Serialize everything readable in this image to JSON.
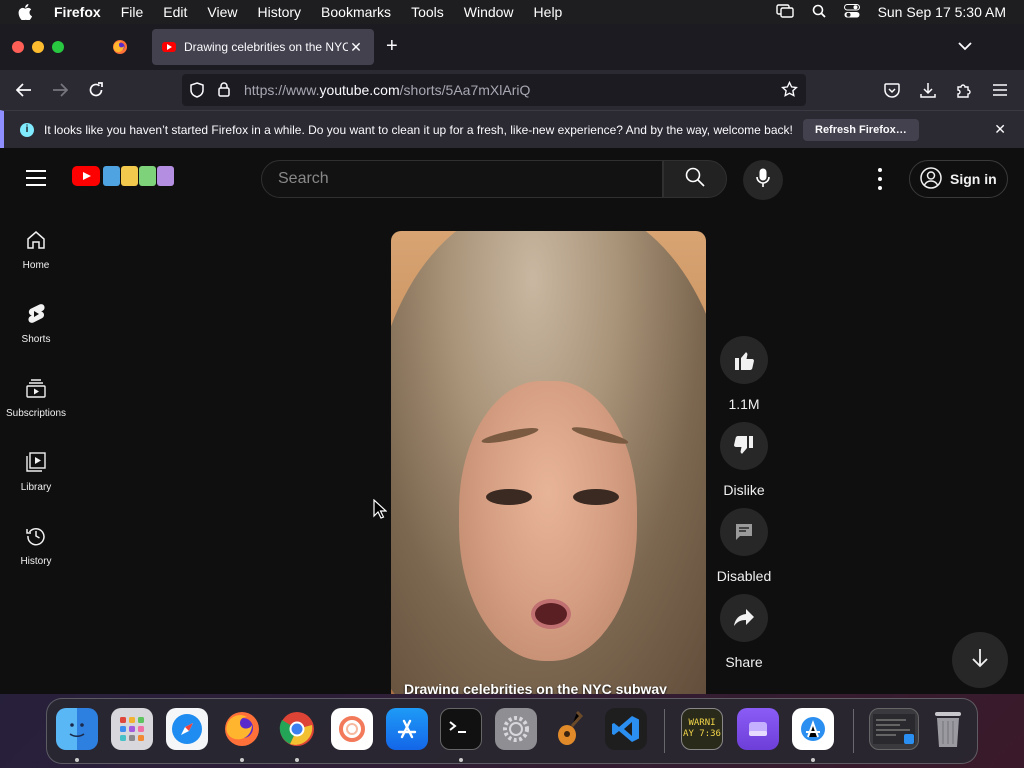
{
  "menubar": {
    "app_name": "Firefox",
    "items": [
      "File",
      "Edit",
      "View",
      "History",
      "Bookmarks",
      "Tools",
      "Window",
      "Help"
    ],
    "datetime": "Sun Sep 17  5:30 AM"
  },
  "browser": {
    "tab_title": "Drawing celebrities on the NYC",
    "url_prefix": "https://www.",
    "url_domain": "youtube.com",
    "url_path": "/shorts/5Aa7mXlAriQ"
  },
  "notification": {
    "message": "It looks like you haven’t started Firefox in a while. Do you want to clean it up for a fresh, like-new experience? And by the way, welcome back!",
    "button": "Refresh Firefox…"
  },
  "youtube": {
    "search_placeholder": "Search",
    "signin_label": "Sign in",
    "sidebar": [
      {
        "label": "Home",
        "icon": "home-icon"
      },
      {
        "label": "Shorts",
        "icon": "shorts-icon"
      },
      {
        "label": "Subscriptions",
        "icon": "subscriptions-icon"
      },
      {
        "label": "Library",
        "icon": "library-icon"
      },
      {
        "label": "History",
        "icon": "history-icon"
      }
    ],
    "video_title": "Drawing celebrities on the NYC subway",
    "actions": {
      "like_count": "1.1M",
      "dislike_label": "Dislike",
      "comments_label": "Disabled",
      "share_label": "Share"
    }
  },
  "dock": {
    "clock_widget": [
      "WARNI",
      "AY 7:36"
    ]
  }
}
